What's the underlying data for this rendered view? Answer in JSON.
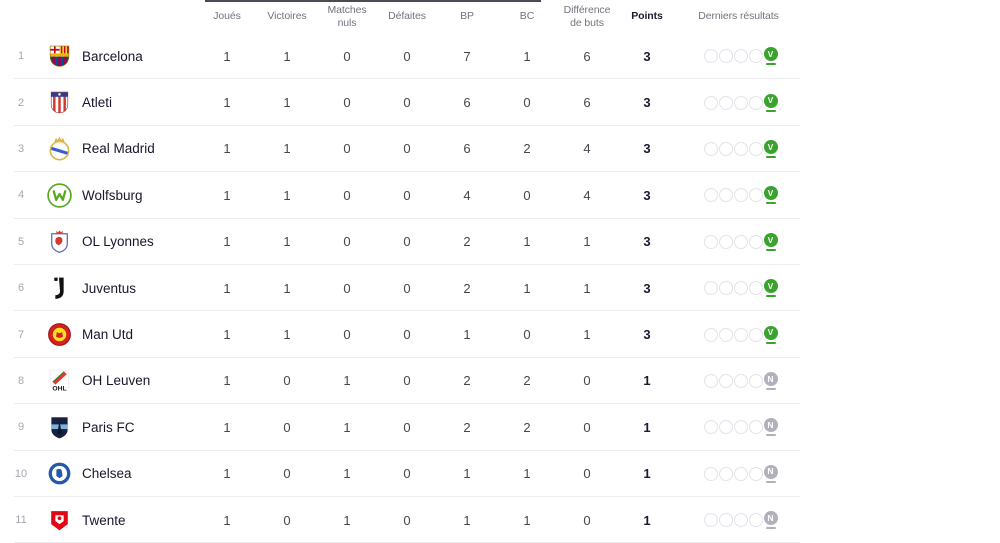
{
  "table": {
    "headers": [
      "Joués",
      "Victoires",
      "Matches nuls",
      "Défaites",
      "BP",
      "BC",
      "Différence de buts",
      "Points",
      "Derniers résultats"
    ],
    "rows": [
      {
        "rank": "1",
        "team": "Barcelona",
        "crest": "barcelona",
        "played": "1",
        "wins": "1",
        "draws": "0",
        "losses": "0",
        "gf": "7",
        "ga": "1",
        "gd": "6",
        "points": "3",
        "last": {
          "letter": "V",
          "type": "win"
        }
      },
      {
        "rank": "2",
        "team": "Atleti",
        "crest": "atleti",
        "played": "1",
        "wins": "1",
        "draws": "0",
        "losses": "0",
        "gf": "6",
        "ga": "0",
        "gd": "6",
        "points": "3",
        "last": {
          "letter": "V",
          "type": "win"
        }
      },
      {
        "rank": "3",
        "team": "Real Madrid",
        "crest": "realmadrid",
        "played": "1",
        "wins": "1",
        "draws": "0",
        "losses": "0",
        "gf": "6",
        "ga": "2",
        "gd": "4",
        "points": "3",
        "last": {
          "letter": "V",
          "type": "win"
        }
      },
      {
        "rank": "4",
        "team": "Wolfsburg",
        "crest": "wolfsburg",
        "played": "1",
        "wins": "1",
        "draws": "0",
        "losses": "0",
        "gf": "4",
        "ga": "0",
        "gd": "4",
        "points": "3",
        "last": {
          "letter": "V",
          "type": "win"
        }
      },
      {
        "rank": "5",
        "team": "OL Lyonnes",
        "crest": "ollyonnes",
        "played": "1",
        "wins": "1",
        "draws": "0",
        "losses": "0",
        "gf": "2",
        "ga": "1",
        "gd": "1",
        "points": "3",
        "last": {
          "letter": "V",
          "type": "win"
        }
      },
      {
        "rank": "6",
        "team": "Juventus",
        "crest": "juventus",
        "played": "1",
        "wins": "1",
        "draws": "0",
        "losses": "0",
        "gf": "2",
        "ga": "1",
        "gd": "1",
        "points": "3",
        "last": {
          "letter": "V",
          "type": "win"
        }
      },
      {
        "rank": "7",
        "team": "Man Utd",
        "crest": "manutd",
        "played": "1",
        "wins": "1",
        "draws": "0",
        "losses": "0",
        "gf": "1",
        "ga": "0",
        "gd": "1",
        "points": "3",
        "last": {
          "letter": "V",
          "type": "win"
        }
      },
      {
        "rank": "8",
        "team": "OH Leuven",
        "crest": "ohleuven",
        "played": "1",
        "wins": "0",
        "draws": "1",
        "losses": "0",
        "gf": "2",
        "ga": "2",
        "gd": "0",
        "points": "1",
        "last": {
          "letter": "N",
          "type": "draw"
        }
      },
      {
        "rank": "9",
        "team": "Paris FC",
        "crest": "parisfc",
        "played": "1",
        "wins": "0",
        "draws": "1",
        "losses": "0",
        "gf": "2",
        "ga": "2",
        "gd": "0",
        "points": "1",
        "last": {
          "letter": "N",
          "type": "draw"
        }
      },
      {
        "rank": "10",
        "team": "Chelsea",
        "crest": "chelsea",
        "played": "1",
        "wins": "0",
        "draws": "1",
        "losses": "0",
        "gf": "1",
        "ga": "1",
        "gd": "0",
        "points": "1",
        "last": {
          "letter": "N",
          "type": "draw"
        }
      },
      {
        "rank": "11",
        "team": "Twente",
        "crest": "twente",
        "played": "1",
        "wins": "0",
        "draws": "1",
        "losses": "0",
        "gf": "1",
        "ga": "1",
        "gd": "0",
        "points": "1",
        "last": {
          "letter": "N",
          "type": "draw"
        }
      }
    ]
  },
  "colors": {
    "win": "#3aa32e",
    "draw": "#b1b1bc",
    "divider": "#ededf1",
    "circle_border": "#e3e3ea"
  },
  "results_display": {
    "empty_slots_per_row": 4
  }
}
